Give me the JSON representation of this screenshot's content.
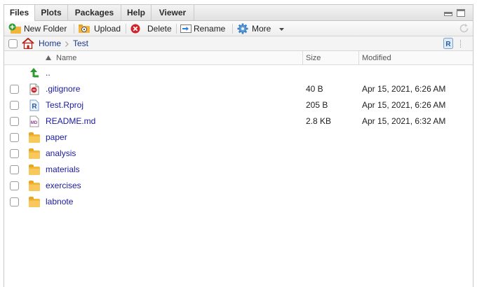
{
  "tabs": [
    {
      "label": "Files",
      "active": true
    },
    {
      "label": "Plots",
      "active": false
    },
    {
      "label": "Packages",
      "active": false
    },
    {
      "label": "Help",
      "active": false
    },
    {
      "label": "Viewer",
      "active": false
    }
  ],
  "toolbar": {
    "new_folder": "New Folder",
    "upload": "Upload",
    "delete": "Delete",
    "rename": "Rename",
    "more": "More"
  },
  "breadcrumb": {
    "home": "Home",
    "current": "Test"
  },
  "columns": {
    "name": "Name",
    "size": "Size",
    "modified": "Modified"
  },
  "files": {
    "parent": "..",
    "rows": [
      {
        "name": ".gitignore",
        "size": "40 B",
        "modified": "Apr 15, 2021, 6:26 AM",
        "icon": "text-file-icon"
      },
      {
        "name": "Test.Rproj",
        "size": "205 B",
        "modified": "Apr 15, 2021, 6:26 AM",
        "icon": "rproj-icon"
      },
      {
        "name": "README.md",
        "size": "2.8 KB",
        "modified": "Apr 15, 2021, 6:32 AM",
        "icon": "markdown-icon"
      },
      {
        "name": "paper",
        "size": "",
        "modified": "",
        "icon": "folder-icon"
      },
      {
        "name": "analysis",
        "size": "",
        "modified": "",
        "icon": "folder-icon"
      },
      {
        "name": "materials",
        "size": "",
        "modified": "",
        "icon": "folder-icon"
      },
      {
        "name": "exercises",
        "size": "",
        "modified": "",
        "icon": "folder-icon"
      },
      {
        "name": "labnote",
        "size": "",
        "modified": "",
        "icon": "folder-icon"
      }
    ]
  },
  "colors": {
    "link": "#1a3a8f",
    "file_name": "#1a1a9e",
    "folder": "#f3b83a"
  }
}
